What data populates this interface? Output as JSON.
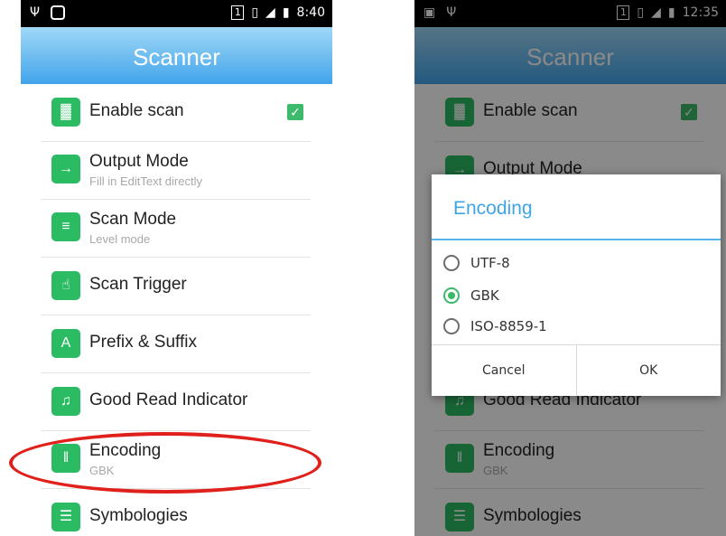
{
  "left_screen": {
    "status_bar": {
      "sim": "1",
      "time": "8:40"
    },
    "title": "Scanner",
    "items": [
      {
        "label": "Enable scan",
        "sub": "",
        "checked": true
      },
      {
        "label": "Output Mode",
        "sub": "Fill in EditText directly"
      },
      {
        "label": "Scan Mode",
        "sub": "Level mode"
      },
      {
        "label": "Scan Trigger",
        "sub": ""
      },
      {
        "label": "Prefix & Suffix",
        "sub": ""
      },
      {
        "label": "Good Read Indicator",
        "sub": ""
      },
      {
        "label": "Encoding",
        "sub": "GBK"
      },
      {
        "label": "Symbologies",
        "sub": ""
      }
    ]
  },
  "right_screen": {
    "status_bar": {
      "sim": "1",
      "time": "12:35"
    },
    "title": "Scanner",
    "items": [
      {
        "label": "Enable scan",
        "checked": true
      },
      {
        "label": "Output Mode"
      },
      {
        "label": "Good Read Indicator"
      },
      {
        "label": "Encoding",
        "sub": "GBK"
      },
      {
        "label": "Symbologies"
      }
    ],
    "dialog": {
      "title": "Encoding",
      "options": [
        {
          "label": "UTF-8",
          "selected": false
        },
        {
          "label": "GBK",
          "selected": true
        },
        {
          "label": "ISO-8859-1",
          "selected": false
        }
      ],
      "cancel": "Cancel",
      "ok": "OK"
    }
  },
  "colors": {
    "accent": "#3fa5e4",
    "icon_green": "#2bbb62",
    "highlight_red": "#e0201a"
  }
}
